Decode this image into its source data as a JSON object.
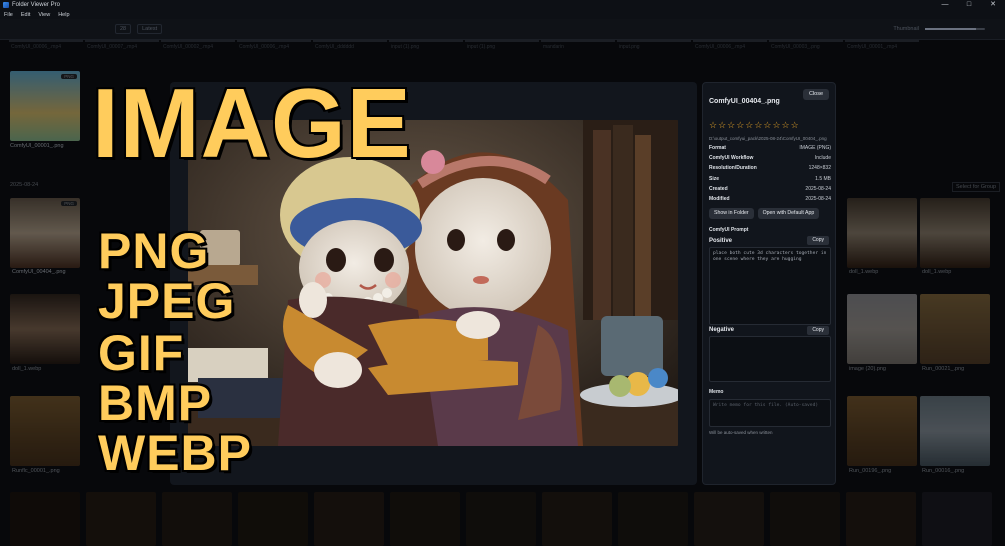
{
  "window": {
    "title": "Folder Viewer Pro",
    "minimize": "—",
    "maximize": "□",
    "close": "✕"
  },
  "menu": [
    "File",
    "Edit",
    "View",
    "Help"
  ],
  "toolbar": {
    "breadcrumb": "",
    "sort": "28",
    "order": "Latest",
    "mode_label": "Thumbnail"
  },
  "top_strip": [
    "ComfyUI_00006_.mp4",
    "ComfyUI_00007_.mp4",
    "ComfyUI_00002_.mp4",
    "ComfyUI_00006_.mp4",
    "ComfyUI_dddddd",
    "input (1).png",
    "input (1).png",
    "mandarin",
    "input.png",
    "ComfyUI_00006_.mp4",
    "ComfyUI_00003_.png",
    "ComfyUI_00001_.mp4"
  ],
  "date_header": "2025-08-24",
  "select_button": "Select for Group",
  "grid_captions": [
    "ComfyUI_00001_.png",
    "ComfyUI_00404_.png",
    "doll_1.webp",
    "doll_1.webp",
    "doll_1.webp",
    "image (20).png",
    "Run_00021_.png",
    "Runflc_00001_.png",
    "Run_00196_.png",
    "Run_00016_.png"
  ],
  "overlay_text": {
    "headline": "IMAGE",
    "formats": [
      "PNG",
      "JPEG",
      "GIF",
      "BMP",
      "WEBP"
    ]
  },
  "details": {
    "filename": "ComfyUI_00404_.png",
    "close_label": "Close",
    "rating_stars": "☆☆☆☆☆☆☆☆☆☆",
    "path": "D:\\output_comfyui_pack\\2025-08-24\\ComfyUI_00404_.png",
    "rows": [
      {
        "label": "Format",
        "value": "IMAGE (PNG)"
      },
      {
        "label": "ComfyUI Workflow",
        "value": "Include"
      },
      {
        "label": "Resolution/Duration",
        "value": "1248×832"
      },
      {
        "label": "Size",
        "value": "1.5 MB"
      },
      {
        "label": "Created",
        "value": "2025-08-24"
      },
      {
        "label": "Modified",
        "value": "2025-08-24"
      }
    ],
    "show_in_folder": "Show in Folder",
    "open_default": "Open with Default App",
    "comfy_prompt_label": "ComfyUI Prompt",
    "positive_label": "Positive",
    "positive_text": "place both cute 3d characters together in one scene where they are hugging",
    "negative_label": "Negative",
    "negative_text": "",
    "copy_label": "Copy",
    "memo_label": "Memo",
    "memo_placeholder": "Write memo for this file. (Auto-saved)",
    "memo_note": "Will be auto-saved when written"
  },
  "colors": {
    "accent_star": "#e8a528",
    "headline": "#ffcc5c",
    "panel_bg": "#11151c"
  }
}
